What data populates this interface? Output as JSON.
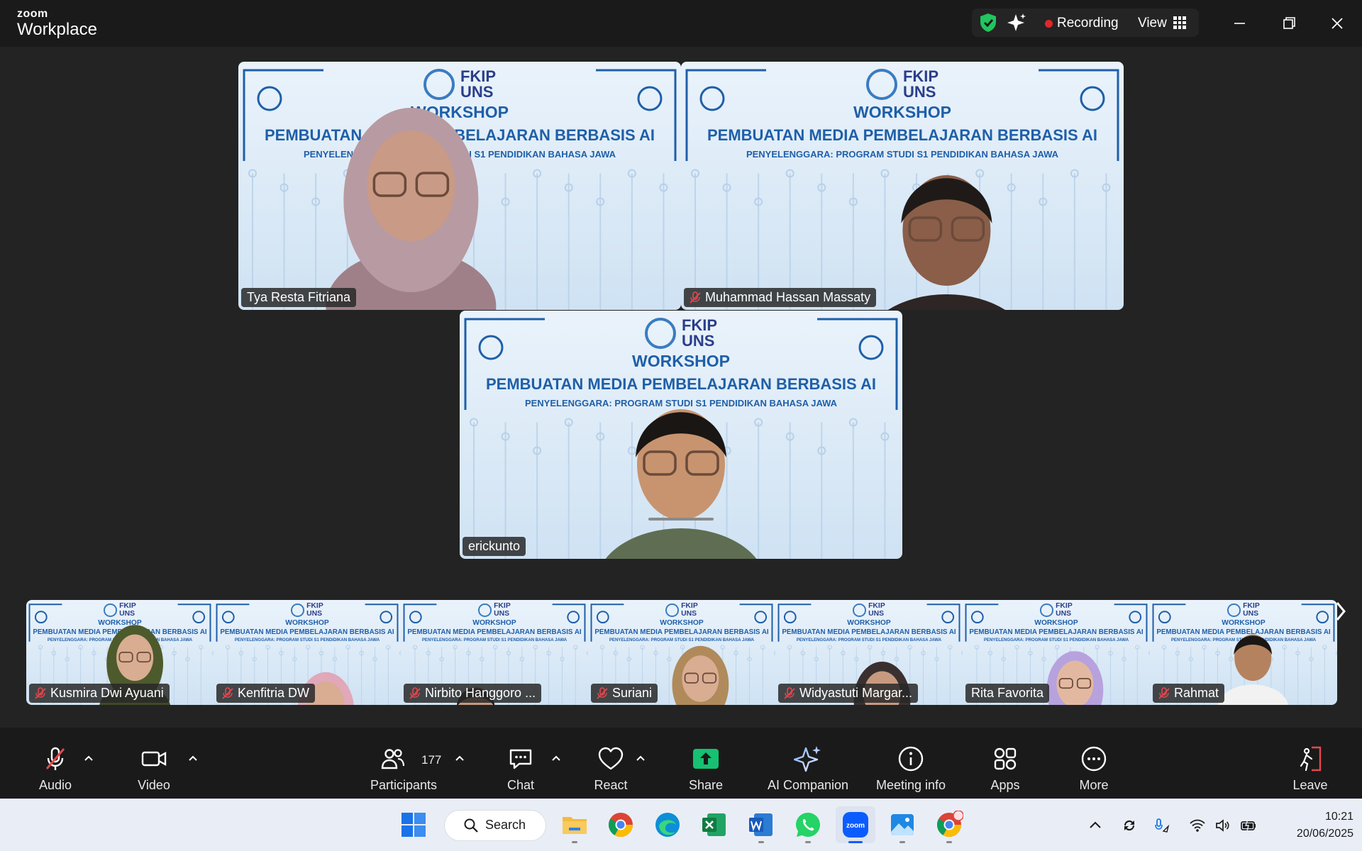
{
  "app": {
    "brand_small": "zoom",
    "brand_large": "Workplace"
  },
  "titlebar": {
    "recording_label": "Recording",
    "view_label": "View"
  },
  "banner": {
    "logo_line1": "FKIP",
    "logo_line2": "UNS",
    "heading": "WORKSHOP",
    "title": "PEMBUATAN MEDIA PEMBELAJARAN BERBASIS AI",
    "subtitle": "PENYELENGGARA: PROGRAM STUDI S1 PENDIDIKAN BAHASA JAWA"
  },
  "gallery": {
    "main": [
      {
        "name": "Tya Resta Fitriana",
        "muted": false
      },
      {
        "name": "Muhammad Hassan Massaty",
        "muted": true
      },
      {
        "name": "erickunto",
        "muted": false
      }
    ],
    "strip": [
      {
        "name": "Kusmira Dwi Ayuani",
        "muted": true
      },
      {
        "name": "Kenfitria DW",
        "muted": true
      },
      {
        "name": "Nirbito Hanggoro ...",
        "muted": true
      },
      {
        "name": "Suriani",
        "muted": true
      },
      {
        "name": "Widyastuti Margar...",
        "muted": true
      },
      {
        "name": "Rita Favorita",
        "muted": false
      },
      {
        "name": "Rahmat",
        "muted": true
      }
    ]
  },
  "toolbar": {
    "audio": "Audio",
    "video": "Video",
    "participants": "Participants",
    "participants_count": "177",
    "chat": "Chat",
    "react": "React",
    "share": "Share",
    "ai_companion": "AI Companion",
    "meeting_info": "Meeting info",
    "apps": "Apps",
    "more": "More",
    "leave": "Leave"
  },
  "taskbar": {
    "search_label": "Search",
    "time": "10:21",
    "date": "20/06/2025"
  },
  "colors": {
    "accent_green": "#22c55e",
    "recording_red": "#e02828",
    "leave_red": "#e5484d",
    "share_green": "#16c172",
    "banner_blue": "#1f5fa8"
  }
}
